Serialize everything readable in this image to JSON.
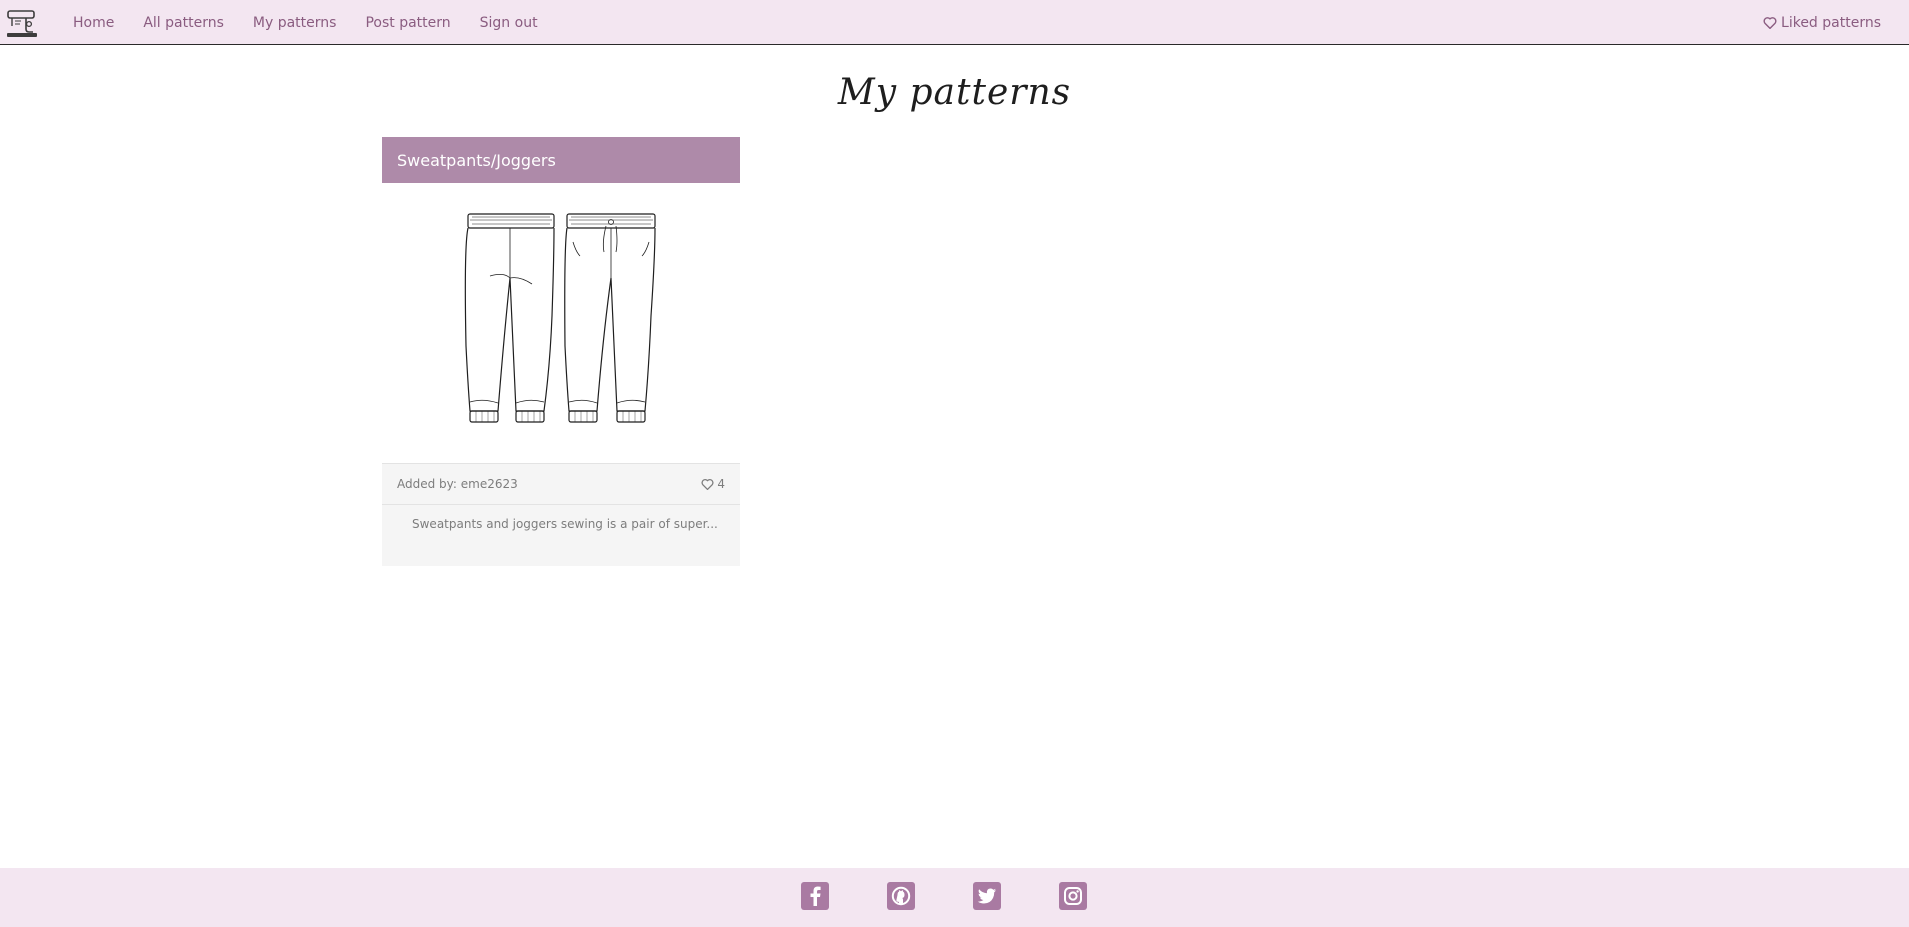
{
  "nav": {
    "links": [
      "Home",
      "All patterns",
      "My patterns",
      "Post pattern",
      "Sign out"
    ],
    "liked_label": "Liked patterns"
  },
  "page": {
    "title": "My patterns"
  },
  "patterns": [
    {
      "title": "Sweatpants/Joggers",
      "added_by": "Added by: eme2623",
      "likes": "4",
      "description": "Sweatpants and joggers sewing is a pair of super..."
    }
  ],
  "footer": {
    "icons": [
      "facebook-icon",
      "github-icon",
      "twitter-icon",
      "instagram-icon"
    ]
  },
  "colors": {
    "nav_bg": "#f3e6f1",
    "link": "#8a5c80",
    "card_header": "#ae8aa9",
    "social": "#a97aa2"
  }
}
